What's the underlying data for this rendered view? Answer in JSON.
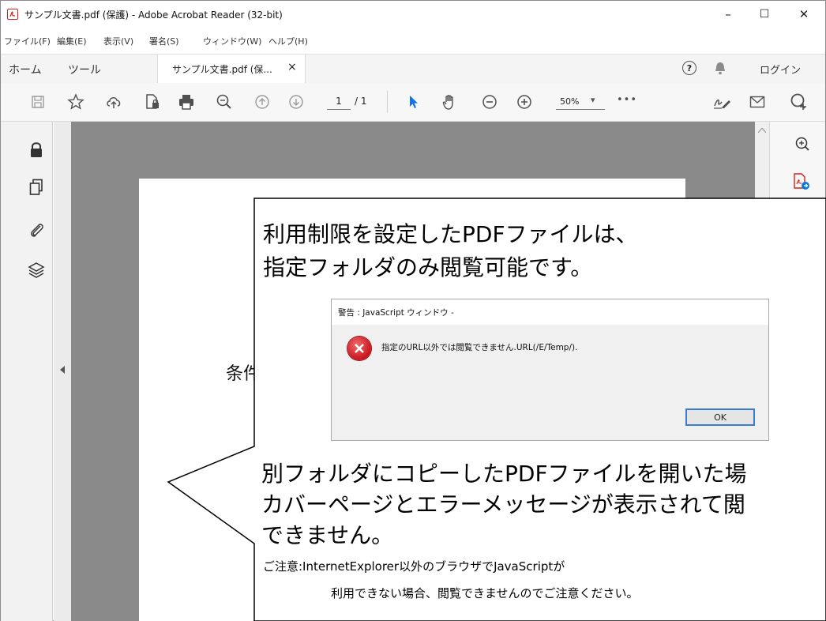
{
  "window": {
    "title": "サンプル文書.pdf (保護) - Adobe Acrobat Reader (32-bit)",
    "controls": {
      "minimize": "–",
      "maximize": "☐",
      "close": "✕"
    }
  },
  "menubar": [
    "ファイル(F)",
    "編集(E)",
    "表示(V)",
    "署名(S)",
    "ウィンドウ(W)",
    "ヘルプ(H)"
  ],
  "tabs": {
    "home": "ホーム",
    "tools": "ツール",
    "document": "サンプル文書.pdf (保...",
    "document_close": "×",
    "help": "?",
    "login": "ログイン"
  },
  "toolbar": {
    "page_current": "1",
    "page_total": "/ 1",
    "zoom": "50%",
    "zoom_arrow": "▾",
    "more": "•••"
  },
  "document": {
    "visible_text": "条件"
  },
  "callout": {
    "heading_line1": "利用制限を設定したPDFファイルは、",
    "heading_line2": "指定フォルダのみ閲覧可能です。",
    "body_line1": "別フォルダにコピーしたPDFファイルを開いた場",
    "body_line2": "カバーページとエラーメッセージが表示されて閲",
    "body_line3": "できません。",
    "note_line1": "ご注意:InternetExplorer以外のブラウザでJavaScriptが",
    "note_line2": "利用できない場合、閲覧できませんのでご注意ください。"
  },
  "dialog": {
    "title": "警告 : JavaScript ウィンドウ -",
    "message": "指定のURL以外では閲覧できません.URL(/E/Temp/).",
    "ok_label": "OK"
  },
  "icons": {
    "accent": "#d3221a",
    "tool_active": "#1473e6"
  }
}
